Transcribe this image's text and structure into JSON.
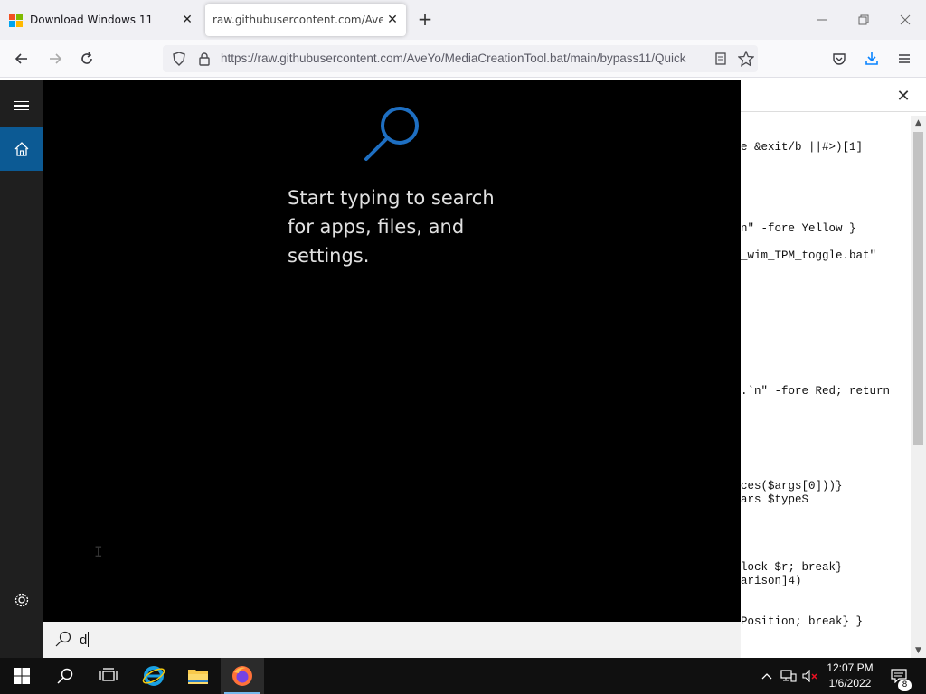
{
  "browser": {
    "tabs": [
      {
        "title": "Download Windows 11",
        "active": false
      },
      {
        "title": "raw.githubusercontent.com/AveYo",
        "active": true
      }
    ],
    "url": "https://raw.githubusercontent.com/AveYo/MediaCreationTool.bat/main/bypass11/Quick"
  },
  "page_text": {
    "lines": [
      "e &exit/b ||#>)[1]",
      "n\" -fore Yellow }",
      "_wim_TPM_toggle.bat\"",
      ".`n\" -fore Red; return",
      "ces($args[0]))}",
      "ars $typeS",
      "lock $r; break}",
      "arison]4)",
      "Position; break} }"
    ]
  },
  "start_search": {
    "hint": "Start typing to search for apps, files, and settings.",
    "query": "d"
  },
  "taskbar": {
    "time": "12:07 PM",
    "date": "1/6/2022",
    "notification_count": "8"
  },
  "colors": {
    "start_accent": "#0c5a94",
    "search_glyph": "#1e6fc2",
    "taskbar_bg": "#101010"
  }
}
